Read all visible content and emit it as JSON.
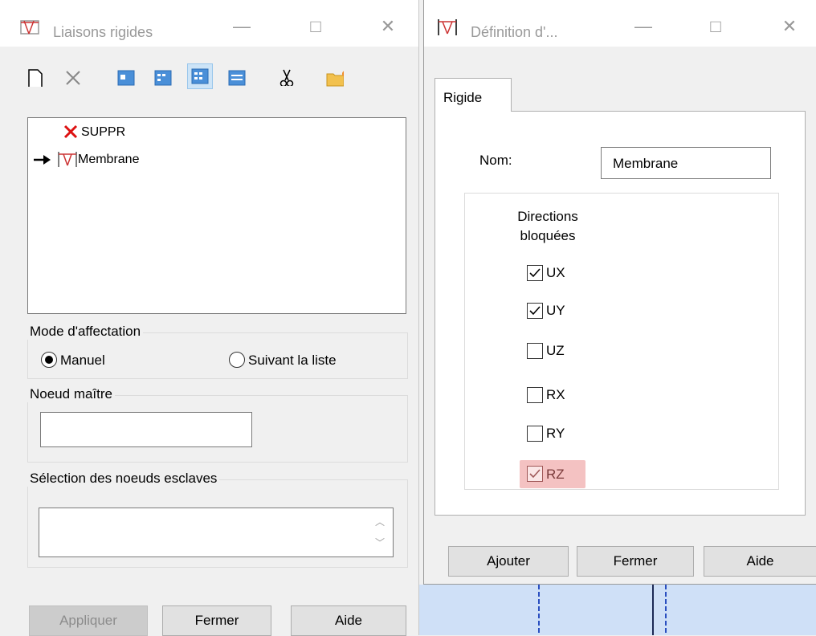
{
  "left_window": {
    "title": "Liaisons rigides",
    "list": {
      "items": [
        {
          "label": "SUPPR",
          "icon": "red-x-icon"
        },
        {
          "label": "Membrane",
          "icon": "rigid-link-icon",
          "current": true
        }
      ]
    },
    "mode_group": {
      "title": "Mode d'affectation",
      "options": [
        "Manuel",
        "Suivant la liste"
      ],
      "selected": "Manuel"
    },
    "master_group": {
      "title": "Noeud maître",
      "value": ""
    },
    "slaves_group": {
      "title": "Sélection des noeuds esclaves",
      "value": ""
    },
    "buttons": {
      "apply": "Appliquer",
      "close": "Fermer",
      "help": "Aide"
    }
  },
  "right_window": {
    "title": "Définition d'...",
    "tab": "Rigide",
    "name_label": "Nom:",
    "name_value": "Membrane",
    "directions_title": "Directions bloquées",
    "directions": [
      {
        "label": "UX",
        "checked": true
      },
      {
        "label": "UY",
        "checked": true
      },
      {
        "label": "UZ",
        "checked": false
      },
      {
        "label": "RX",
        "checked": false
      },
      {
        "label": "RY",
        "checked": false
      },
      {
        "label": "RZ",
        "checked": true,
        "highlighted": true
      }
    ],
    "buttons": {
      "add": "Ajouter",
      "close": "Fermer",
      "help": "Aide"
    }
  },
  "colors": {
    "highlight": "#f4c2c2",
    "selected_tool": "#cde4f7",
    "background_canvas": "#cfe0f7"
  }
}
